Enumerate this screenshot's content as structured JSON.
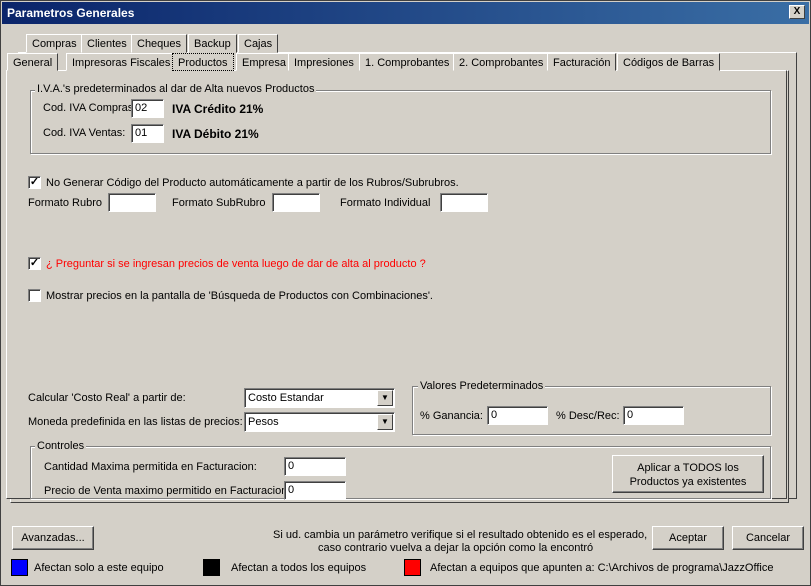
{
  "window": {
    "title": "Parametros Generales",
    "close_label": "X"
  },
  "tabs_row1": [
    "Compras",
    "Clientes",
    "Cheques",
    "Backup",
    "Cajas"
  ],
  "tabs_row2": [
    "General",
    "Impresoras Fiscales",
    "Productos",
    "Empresa",
    "Impresiones",
    "1. Comprobantes",
    "2. Comprobantes",
    "Facturación",
    "Códigos de Barras"
  ],
  "iva": {
    "group_title": "I.V.A.'s predeterminados al dar de Alta nuevos Productos",
    "compras_label": "Cod. IVA Compras",
    "compras_value": "02",
    "compras_desc": "IVA Crédito 21%",
    "ventas_label": "Cod. IVA Ventas:",
    "ventas_value": "01",
    "ventas_desc": "IVA Débito 21%"
  },
  "codigo": {
    "checkbox_label": "No Generar Código del Producto automáticamente a partir de los Rubros/Subrubros.",
    "checked": true,
    "formato_rubro_label": "Formato Rubro",
    "formato_rubro_value": "",
    "formato_subrubro_label": "Formato SubRubro",
    "formato_subrubro_value": "",
    "formato_individual_label": "Formato Individual",
    "formato_individual_value": ""
  },
  "preguntar": {
    "label": "¿ Preguntar si se ingresan precios de venta luego de dar de alta al producto ?",
    "checked": true
  },
  "mostrar": {
    "label": "Mostrar precios en la pantalla de 'Búsqueda de Productos con Combinaciones'.",
    "checked": false
  },
  "costo": {
    "label": "Calcular 'Costo Real' a partir de:",
    "value": "Costo Estandar"
  },
  "moneda": {
    "label": "Moneda predefinida en las listas de precios:",
    "value": "Pesos"
  },
  "valores": {
    "group_title": "Valores Predeterminados",
    "ganancia_label": "% Ganancia:",
    "ganancia_value": "0",
    "desc_label": "% Desc/Rec:",
    "desc_value": "0"
  },
  "controles": {
    "group_title": "Controles",
    "cantidad_label": "Cantidad Maxima permitida en Facturacion:",
    "cantidad_value": "0",
    "precio_label": "Precio de Venta maximo permitido en Facturacion:",
    "precio_value": "0",
    "aplicar_line1": "Aplicar a TODOS los",
    "aplicar_line2": "Productos ya existentes"
  },
  "footer": {
    "avanzadas_label": "Avanzadas...",
    "note_line1": "Si ud. cambia un parámetro verifique si el resultado obtenido es el esperado,",
    "note_line2": "caso contrario vuelva a dejar la opción como la encontró",
    "aceptar_label": "Aceptar",
    "cancelar_label": "Cancelar"
  },
  "legend": [
    {
      "color": "#0000ff",
      "label": "Afectan solo a este equipo"
    },
    {
      "color": "#000000",
      "label": "Afectan a todos los equipos"
    },
    {
      "color": "#ff0000",
      "label": "Afectan a equipos que apunten a: C:\\Archivos de programa\\JazzOffice"
    }
  ]
}
